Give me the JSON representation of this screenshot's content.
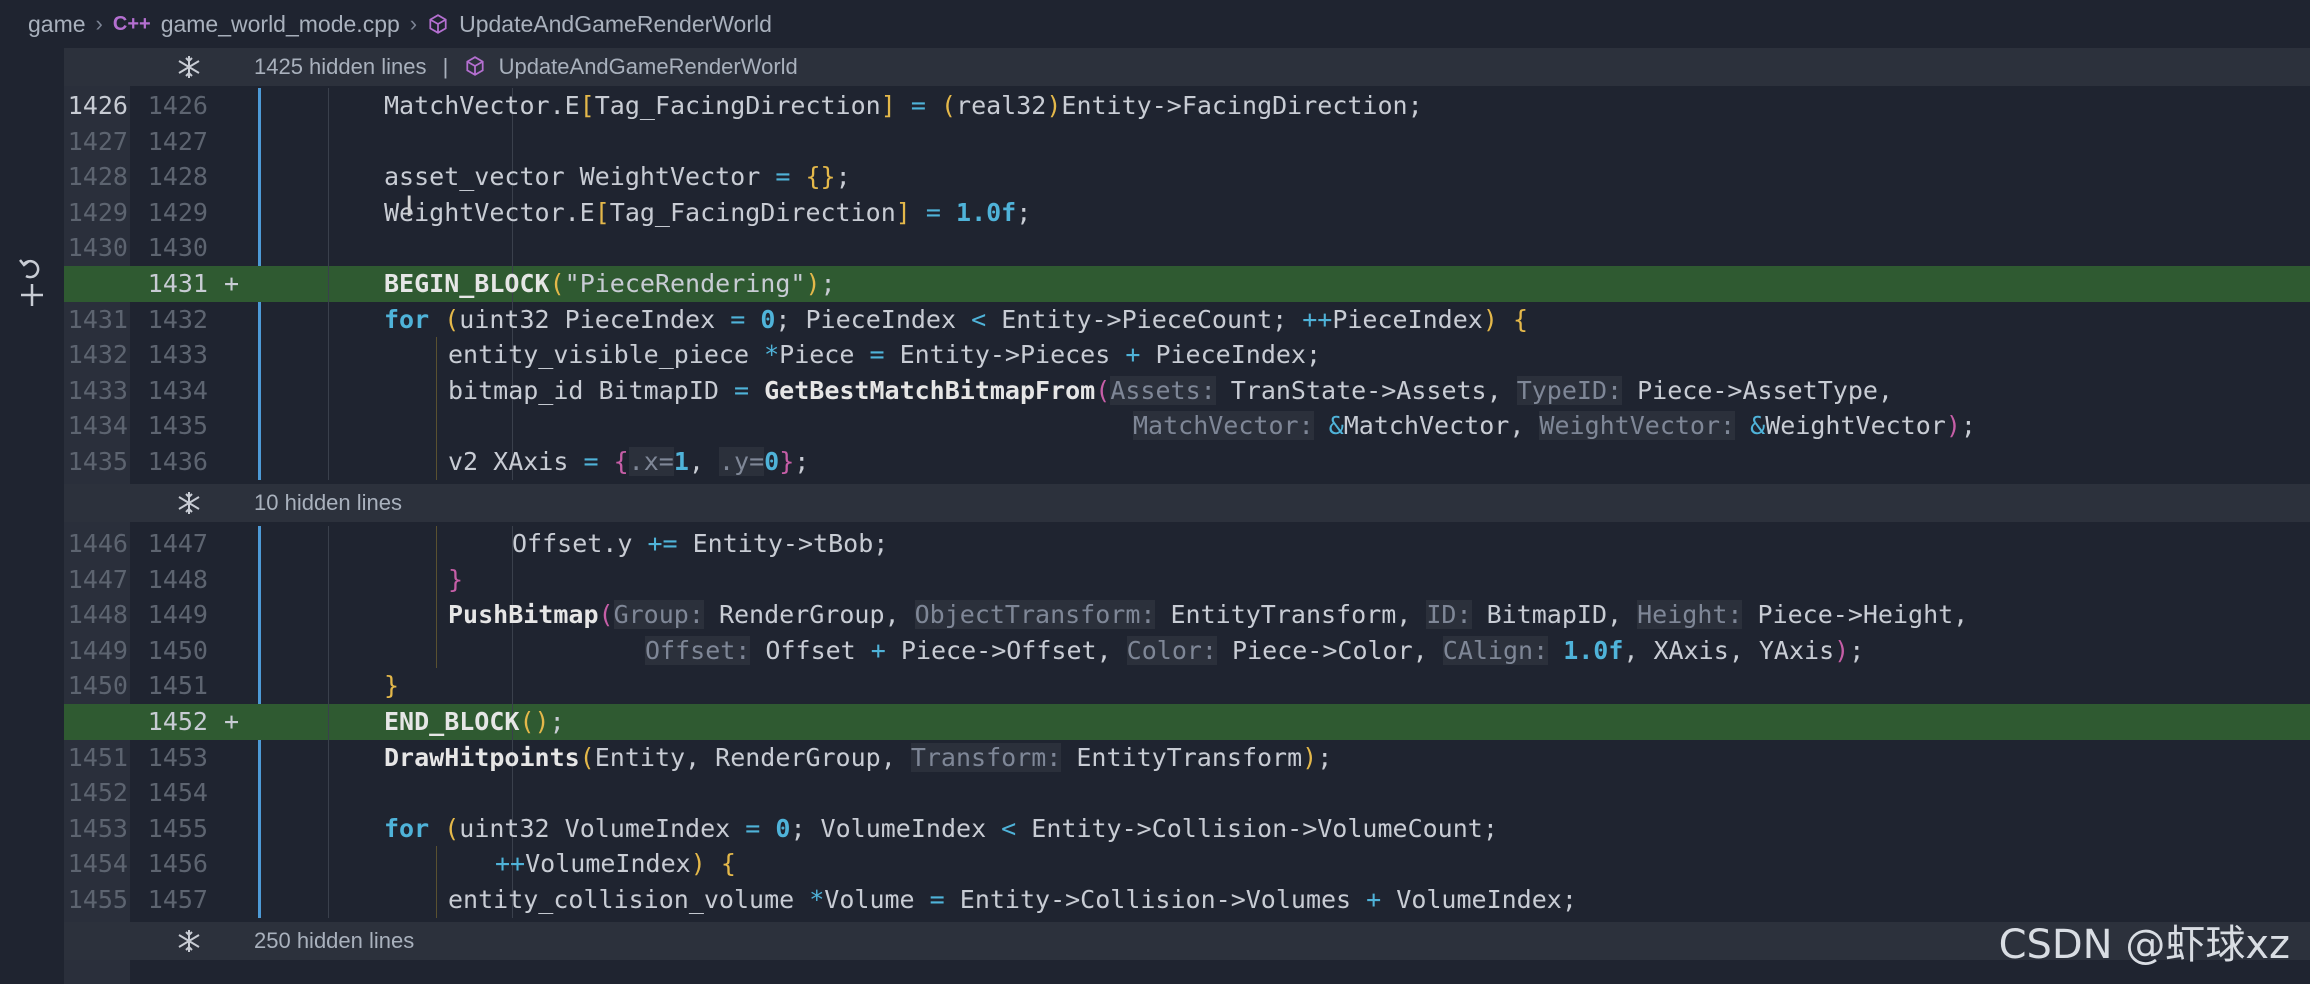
{
  "breadcrumb": {
    "root": "game",
    "file": "game_world_mode.cpp",
    "file_icon": "cpp-file-icon",
    "symbol": "UpdateAndGameRenderWorld"
  },
  "folds": [
    {
      "text": "1425 hidden lines",
      "separator": "|",
      "symbol": "UpdateAndGameRenderWorld"
    },
    {
      "text": "10 hidden lines"
    },
    {
      "text": "250 hidden lines"
    }
  ],
  "watermark": "CSDN @虾球xz",
  "colors": {
    "added_bg": "#2f5a31",
    "keyword": "#4fb3d9",
    "gutter_bar": "#4d9ad6"
  },
  "block1": [
    {
      "old": "1426",
      "new": "1426",
      "cur": true,
      "segs": [
        [
          "",
          "MatchVector.E"
        ],
        [
          "py",
          "["
        ],
        [
          "",
          "Tag_FacingDirection"
        ],
        [
          "py",
          "]"
        ],
        [
          "",
          " "
        ],
        [
          "op",
          "="
        ],
        [
          "",
          " "
        ],
        [
          "py",
          "("
        ],
        [
          "",
          "real32"
        ],
        [
          "py",
          ")"
        ],
        [
          "",
          "Entity->FacingDirection;"
        ]
      ]
    },
    {
      "old": "1427",
      "new": "1427",
      "segs": []
    },
    {
      "old": "1428",
      "new": "1428",
      "segs": [
        [
          "",
          "asset_vector WeightVector "
        ],
        [
          "op",
          "="
        ],
        [
          "",
          " "
        ],
        [
          "py",
          "{}"
        ],
        [
          "",
          ";"
        ]
      ]
    },
    {
      "old": "1429",
      "new": "1429",
      "segs": [
        [
          "",
          "WeightVector.E"
        ],
        [
          "py",
          "["
        ],
        [
          "",
          "Tag_FacingDirection"
        ],
        [
          "py",
          "]"
        ],
        [
          "",
          " "
        ],
        [
          "op",
          "="
        ],
        [
          "",
          " "
        ],
        [
          "num",
          "1.0f"
        ],
        [
          "",
          ";"
        ]
      ]
    },
    {
      "old": "1430",
      "new": "1430",
      "segs": []
    },
    {
      "old": "",
      "new": "1431",
      "added": true,
      "segs": [
        [
          "fn",
          "BEGIN_BLOCK"
        ],
        [
          "py",
          "("
        ],
        [
          "",
          "\"PieceRendering\""
        ],
        [
          "py",
          ")"
        ],
        [
          "",
          ";"
        ]
      ]
    },
    {
      "old": "1431",
      "new": "1432",
      "segs": [
        [
          "kw",
          "for"
        ],
        [
          "",
          " "
        ],
        [
          "py",
          "("
        ],
        [
          "",
          "uint32 PieceIndex "
        ],
        [
          "op",
          "="
        ],
        [
          "",
          " "
        ],
        [
          "num",
          "0"
        ],
        [
          "",
          "; PieceIndex "
        ],
        [
          "op",
          "<"
        ],
        [
          "",
          " Entity->PieceCount; "
        ],
        [
          "op",
          "++"
        ],
        [
          "",
          "PieceIndex"
        ],
        [
          "py",
          ")"
        ],
        [
          "",
          " "
        ],
        [
          "py",
          "{"
        ]
      ]
    },
    {
      "old": "1432",
      "new": "1433",
      "indent": 1,
      "segs": [
        [
          "",
          "entity_visible_piece "
        ],
        [
          "op",
          "*"
        ],
        [
          "",
          "Piece "
        ],
        [
          "op",
          "="
        ],
        [
          "",
          " Entity->Pieces "
        ],
        [
          "op",
          "+"
        ],
        [
          "",
          " PieceIndex;"
        ]
      ]
    },
    {
      "old": "1433",
      "new": "1434",
      "indent": 1,
      "segs": [
        [
          "",
          "bitmap_id BitmapID "
        ],
        [
          "op",
          "="
        ],
        [
          "",
          " "
        ],
        [
          "fn",
          "GetBestMatchBitmapFrom"
        ],
        [
          "pp",
          "("
        ],
        [
          "hint",
          "Assets:"
        ],
        [
          "",
          " TranState->Assets, "
        ],
        [
          "hint",
          "TypeID:"
        ],
        [
          "",
          " Piece->AssetType,"
        ]
      ]
    },
    {
      "old": "1434",
      "new": "1435",
      "pad": 12,
      "segs": [
        [
          "hint",
          "MatchVector:"
        ],
        [
          "",
          " "
        ],
        [
          "op",
          "&"
        ],
        [
          "",
          "MatchVector, "
        ],
        [
          "hint",
          "WeightVector:"
        ],
        [
          "",
          " "
        ],
        [
          "op",
          "&"
        ],
        [
          "",
          "WeightVector"
        ],
        [
          "pp",
          ")"
        ],
        [
          "",
          ";"
        ]
      ]
    },
    {
      "old": "1435",
      "new": "1436",
      "indent": 1,
      "segs": [
        [
          "",
          "v2 XAxis "
        ],
        [
          "op",
          "="
        ],
        [
          "",
          " "
        ],
        [
          "pp",
          "{"
        ],
        [
          "hint",
          ".x="
        ],
        [
          "num",
          "1"
        ],
        [
          "",
          ", "
        ],
        [
          "hint",
          ".y="
        ],
        [
          "num",
          "0"
        ],
        [
          "pp",
          "}"
        ],
        [
          "",
          ";"
        ]
      ]
    }
  ],
  "block2": [
    {
      "old": "1446",
      "new": "1447",
      "indent": 2,
      "segs": [
        [
          "",
          "Offset.y "
        ],
        [
          "op",
          "+="
        ],
        [
          "",
          " Entity->tBob;"
        ]
      ]
    },
    {
      "old": "1447",
      "new": "1448",
      "indent": 1,
      "segs": [
        [
          "pp",
          "}"
        ]
      ]
    },
    {
      "old": "1448",
      "new": "1449",
      "indent": 1,
      "segs": [
        [
          "fn",
          "PushBitmap"
        ],
        [
          "pp",
          "("
        ],
        [
          "hint",
          "Group:"
        ],
        [
          "",
          " RenderGroup, "
        ],
        [
          "hint",
          "ObjectTransform:"
        ],
        [
          "",
          " EntityTransform, "
        ],
        [
          "hint",
          "ID:"
        ],
        [
          "",
          " BitmapID, "
        ],
        [
          "hint",
          "Height:"
        ],
        [
          "",
          " Piece->Height,"
        ]
      ]
    },
    {
      "old": "1449",
      "new": "1450",
      "pad": 4,
      "segs": [
        [
          "hint",
          "Offset:"
        ],
        [
          "",
          " Offset "
        ],
        [
          "op",
          "+"
        ],
        [
          "",
          " Piece->Offset, "
        ],
        [
          "hint",
          "Color:"
        ],
        [
          "",
          " Piece->Color, "
        ],
        [
          "hint",
          "CAlign:"
        ],
        [
          "",
          " "
        ],
        [
          "num",
          "1.0f"
        ],
        [
          "",
          ", XAxis, YAxis"
        ],
        [
          "pp",
          ")"
        ],
        [
          "",
          ";"
        ]
      ]
    },
    {
      "old": "1450",
      "new": "1451",
      "segs": [
        [
          "py",
          "}"
        ]
      ]
    },
    {
      "old": "",
      "new": "1452",
      "added": true,
      "segs": [
        [
          "fn",
          "END_BLOCK"
        ],
        [
          "py",
          "()"
        ],
        [
          "",
          ";"
        ]
      ]
    },
    {
      "old": "1451",
      "new": "1453",
      "segs": [
        [
          "fn",
          "DrawHitpoints"
        ],
        [
          "py",
          "("
        ],
        [
          "",
          "Entity, RenderGroup, "
        ],
        [
          "hint",
          "Transform:"
        ],
        [
          "",
          " EntityTransform"
        ],
        [
          "py",
          ")"
        ],
        [
          "",
          ";"
        ]
      ]
    },
    {
      "old": "1452",
      "new": "1454",
      "segs": []
    },
    {
      "old": "1453",
      "new": "1455",
      "segs": [
        [
          "kw",
          "for"
        ],
        [
          "",
          " "
        ],
        [
          "py",
          "("
        ],
        [
          "",
          "uint32 VolumeIndex "
        ],
        [
          "op",
          "="
        ],
        [
          "",
          " "
        ],
        [
          "num",
          "0"
        ],
        [
          "",
          "; VolumeIndex "
        ],
        [
          "op",
          "<"
        ],
        [
          "",
          " Entity->Collision->VolumeCount;"
        ]
      ]
    },
    {
      "old": "1454",
      "new": "1456",
      "pad": 1,
      "segs": [
        [
          "op",
          "++"
        ],
        [
          "",
          "VolumeIndex"
        ],
        [
          "py",
          ")"
        ],
        [
          "",
          " "
        ],
        [
          "py",
          "{"
        ]
      ]
    },
    {
      "old": "1455",
      "new": "1457",
      "indent": 1,
      "segs": [
        [
          "",
          "entity_collision_volume "
        ],
        [
          "op",
          "*"
        ],
        [
          "",
          "Volume "
        ],
        [
          "op",
          "="
        ],
        [
          "",
          " Entity->Collision->Volumes "
        ],
        [
          "op",
          "+"
        ],
        [
          "",
          " VolumeIndex;"
        ]
      ]
    }
  ]
}
